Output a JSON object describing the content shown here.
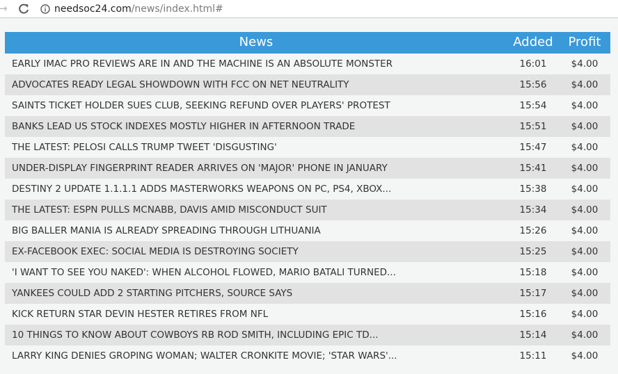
{
  "browser": {
    "url_host": "needsoc24.com",
    "url_path": "/news/index.html#"
  },
  "colors": {
    "header_bg": "#3a99d9",
    "row_alt_bg": "#e2e2e2",
    "page_bg": "#f4f5f5"
  },
  "table": {
    "headers": {
      "news": "News",
      "added": "Added",
      "profit": "Profit"
    },
    "rows": [
      {
        "title": "EARLY IMAC PRO REVIEWS ARE IN AND THE MACHINE IS AN ABSOLUTE MONSTER",
        "time": "16:01",
        "profit": "$4.00"
      },
      {
        "title": "ADVOCATES READY LEGAL SHOWDOWN WITH FCC ON NET NEUTRALITY",
        "time": "15:56",
        "profit": "$4.00"
      },
      {
        "title": "SAINTS TICKET HOLDER SUES CLUB, SEEKING REFUND OVER PLAYERS' PROTEST",
        "time": "15:54",
        "profit": "$4.00"
      },
      {
        "title": "BANKS LEAD US STOCK INDEXES MOSTLY HIGHER IN AFTERNOON TRADE",
        "time": "15:51",
        "profit": "$4.00"
      },
      {
        "title": "THE LATEST: PELOSI CALLS TRUMP TWEET 'DISGUSTING'",
        "time": "15:47",
        "profit": "$4.00"
      },
      {
        "title": "UNDER-DISPLAY FINGERPRINT READER ARRIVES ON 'MAJOR' PHONE IN JANUARY",
        "time": "15:41",
        "profit": "$4.00"
      },
      {
        "title": "DESTINY 2 UPDATE 1.1.1.1 ADDS MASTERWORKS WEAPONS ON PC, PS4, XBOX...",
        "time": "15:38",
        "profit": "$4.00"
      },
      {
        "title": "THE LATEST: ESPN PULLS MCNABB, DAVIS AMID MISCONDUCT SUIT",
        "time": "15:34",
        "profit": "$4.00"
      },
      {
        "title": "BIG BALLER MANIA IS ALREADY SPREADING THROUGH LITHUANIA",
        "time": "15:26",
        "profit": "$4.00"
      },
      {
        "title": "EX-FACEBOOK EXEC: SOCIAL MEDIA IS DESTROYING SOCIETY",
        "time": "15:25",
        "profit": "$4.00"
      },
      {
        "title": "'I WANT TO SEE YOU NAKED': WHEN ALCOHOL FLOWED, MARIO BATALI TURNED...",
        "time": "15:18",
        "profit": "$4.00"
      },
      {
        "title": "YANKEES COULD ADD 2 STARTING PITCHERS, SOURCE SAYS",
        "time": "15:17",
        "profit": "$4.00"
      },
      {
        "title": "KICK RETURN STAR DEVIN HESTER RETIRES FROM NFL",
        "time": "15:16",
        "profit": "$4.00"
      },
      {
        "title": "10 THINGS TO KNOW ABOUT COWBOYS RB ROD SMITH, INCLUDING EPIC TD...",
        "time": "15:14",
        "profit": "$4.00"
      },
      {
        "title": "LARRY KING DENIES GROPING WOMAN; WALTER CRONKITE MOVIE; 'STAR WARS'...",
        "time": "15:11",
        "profit": "$4.00"
      }
    ]
  }
}
